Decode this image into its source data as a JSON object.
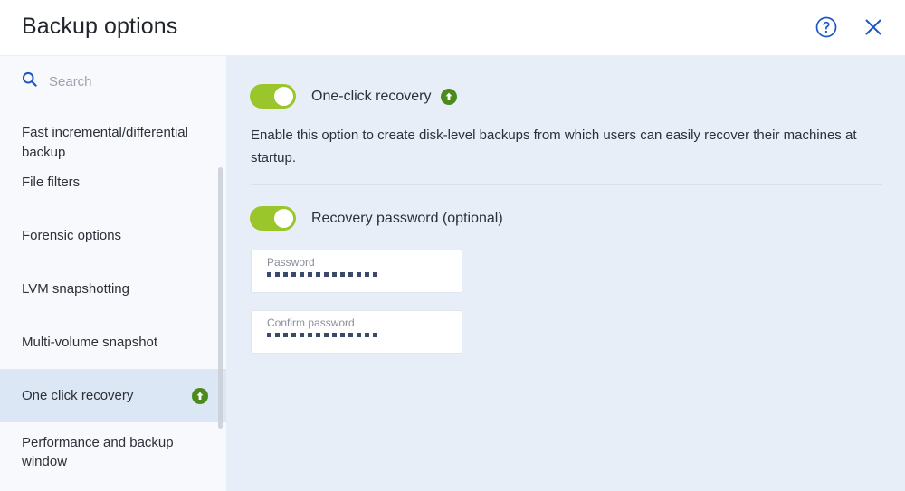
{
  "header": {
    "title": "Backup options",
    "help_icon": "help-circle-icon",
    "close_icon": "close-icon"
  },
  "sidebar": {
    "search": {
      "icon": "search-icon",
      "placeholder": "Search"
    },
    "items": [
      {
        "label": "Fast incremental/differential backup",
        "selected": false,
        "badge": false,
        "clipped": true
      },
      {
        "label": "File filters",
        "selected": false,
        "badge": false
      },
      {
        "label": "Forensic options",
        "selected": false,
        "badge": false
      },
      {
        "label": "LVM snapshotting",
        "selected": false,
        "badge": false
      },
      {
        "label": "Multi-volume snapshot",
        "selected": false,
        "badge": false
      },
      {
        "label": "One click recovery",
        "selected": true,
        "badge": true
      },
      {
        "label": "Performance and backup window",
        "selected": false,
        "badge": false
      }
    ]
  },
  "main": {
    "one_click_recovery": {
      "label": "One-click recovery",
      "toggle_on": true,
      "badge_icon": "upgrade-arrow-icon",
      "description": "Enable this option to create disk-level backups from which users can easily recover their machines at startup."
    },
    "recovery_password": {
      "label": "Recovery password (optional)",
      "toggle_on": true,
      "password_field": {
        "label": "Password",
        "value": "••••••••••••••",
        "dots": 14
      },
      "confirm_field": {
        "label": "Confirm password",
        "value": "••••••••••••••",
        "dots": 14
      }
    }
  },
  "colors": {
    "accent_blue": "#1a57c4",
    "toggle_green": "#9ac62b",
    "badge_green": "#4b8b1e",
    "selected_row": "#dce7f5",
    "main_bg": "#e7eef8",
    "sidebar_bg": "#f7f9fc"
  }
}
